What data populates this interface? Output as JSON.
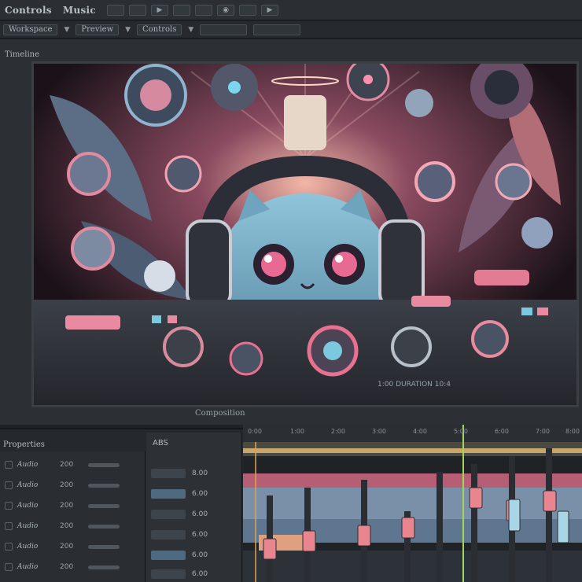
{
  "menu": {
    "items": [
      "Controls",
      "Music"
    ],
    "icons": [
      "play-icon",
      "eye-icon",
      "expand-icon"
    ]
  },
  "toolbar": {
    "buttons": [
      "Workspace",
      "Preview",
      "Controls"
    ]
  },
  "viewer": {
    "label": "Timeline",
    "composition_label": "Composition",
    "strip_text": "1:00 DURATION 10:4"
  },
  "timeline": {
    "panel_title": "Properties",
    "param_header": "ABS",
    "ruler": [
      "0:00",
      "1:00",
      "2:00",
      "3:00",
      "4:00",
      "5:00",
      "6:00",
      "7:00",
      "8:00"
    ],
    "layers": [
      {
        "label": "Audio",
        "value": "200"
      },
      {
        "label": "Audio",
        "value": "200"
      },
      {
        "label": "Audio",
        "value": "200"
      },
      {
        "label": "Audio",
        "value": "200"
      },
      {
        "label": "Audio",
        "value": "200"
      },
      {
        "label": "Audio",
        "value": "200"
      }
    ],
    "params": [
      "8.00",
      "6.00",
      "6.00",
      "6.00",
      "6.00",
      "6.00"
    ]
  },
  "colors": {
    "accent_pink": "#e8789a",
    "accent_cyan": "#7cc8df",
    "panel_bg": "#2a2e32",
    "track_pink": "#c86b7e",
    "track_blue": "#6f8aa3"
  }
}
